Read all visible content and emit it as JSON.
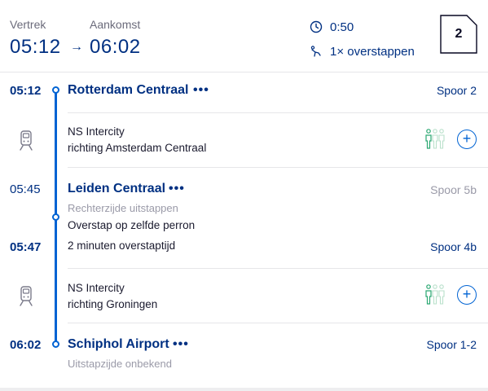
{
  "header": {
    "departure_label": "Vertrek",
    "arrival_label": "Aankomst",
    "departure_time": "05:12",
    "arrow": "→",
    "arrival_time": "06:02",
    "duration": "0:50",
    "transfers": "1× overstappen",
    "crowd_badge": "2"
  },
  "stops": [
    {
      "time": "05:12",
      "station": "Rotterdam Centraal",
      "more": "•••",
      "platform": "Spoor 2"
    },
    {
      "time": "05:45",
      "station": "Leiden Centraal",
      "more": "•••",
      "platform": "Spoor 5b",
      "note": "Rechterzijde uitstappen",
      "transfer_note": "Overstap op zelfde perron"
    },
    {
      "time": "05:47",
      "info": "2 minuten overstaptijd",
      "platform": "Spoor 4b"
    },
    {
      "time": "06:02",
      "station": "Schiphol Airport",
      "more": "•••",
      "platform": "Spoor 1-2",
      "note": "Uitstapzijde onbekend"
    }
  ],
  "legs": [
    {
      "train": "NS Intercity",
      "direction": "richting Amsterdam Centraal"
    },
    {
      "train": "NS Intercity",
      "direction": "richting Groningen"
    }
  ],
  "icons": {
    "clock": "clock-icon",
    "transfer": "transfer-icon",
    "train": "train-icon",
    "crowd": "crowd-icon",
    "add": "plus-circle-icon"
  },
  "colors": {
    "brand_blue": "#003082",
    "line_blue": "#0063d3",
    "crowd_green": "#2aa872",
    "muted": "#9a9aa8"
  }
}
